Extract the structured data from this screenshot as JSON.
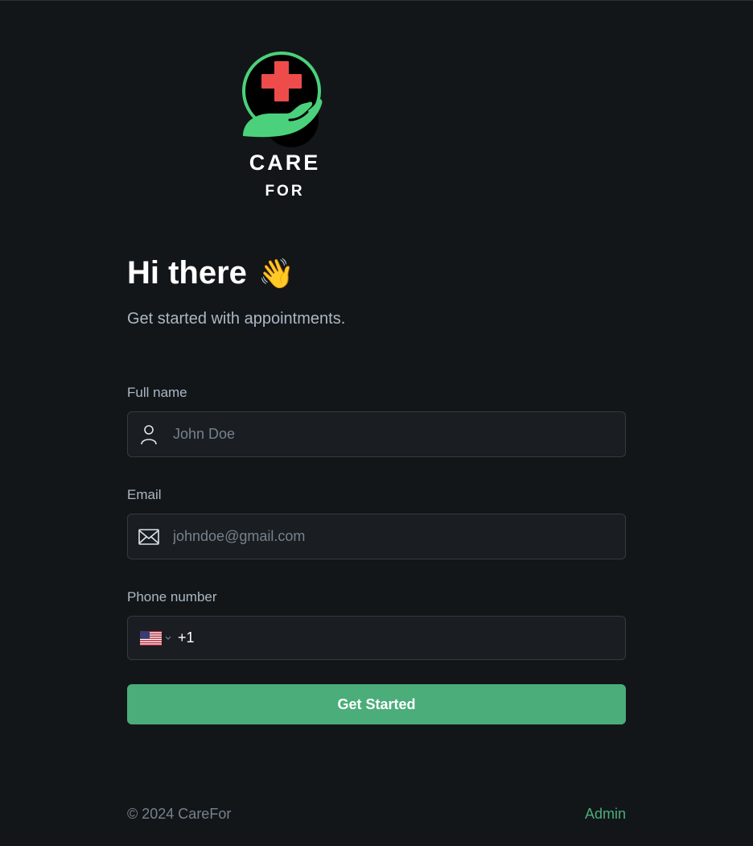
{
  "brand": {
    "line1": "CARE",
    "line2": "FOR",
    "colors": {
      "cross": "#ee4b4b",
      "hand": "#4bd17b",
      "ring": "#4bd17b"
    }
  },
  "header": {
    "title": "Hi there",
    "emoji": "👋",
    "subtitle": "Get started with appointments."
  },
  "form": {
    "full_name": {
      "label": "Full name",
      "placeholder": "John Doe",
      "icon": "user-icon"
    },
    "email": {
      "label": "Email",
      "placeholder": "johndoe@gmail.com",
      "icon": "mail-icon"
    },
    "phone": {
      "label": "Phone number",
      "country": "US",
      "dial_code": "+1",
      "icon": "us-flag-icon"
    },
    "submit_label": "Get Started"
  },
  "footer": {
    "copyright": "© 2024 CareFor",
    "admin_link": "Admin"
  },
  "theme": {
    "background": "#131619",
    "accent": "#4aad7a",
    "muted_text": "#abb8c4"
  }
}
